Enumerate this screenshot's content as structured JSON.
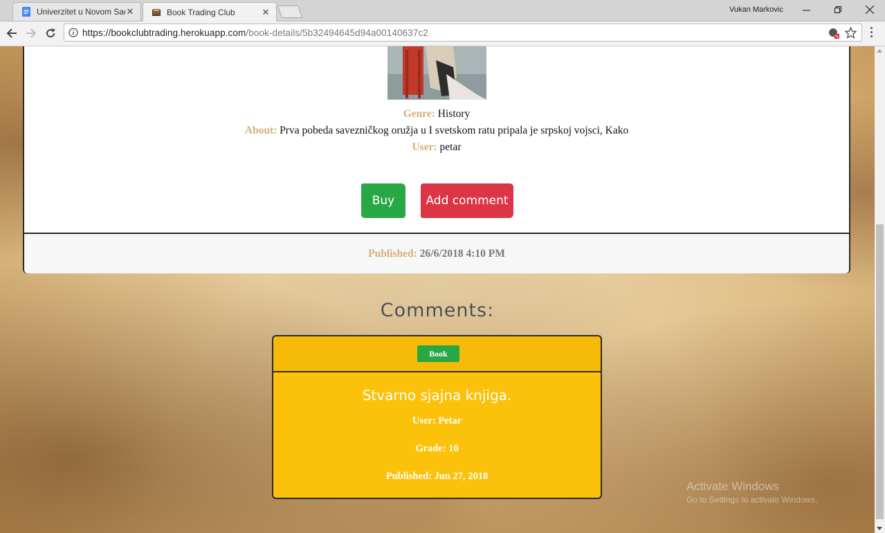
{
  "browser": {
    "tabs": [
      {
        "title": "Univerzitet u Novom Sad",
        "active": false,
        "favicon": "docs-icon"
      },
      {
        "title": "Book Trading Club",
        "active": true,
        "favicon": "book-icon"
      }
    ],
    "profile_name": "Vukan Markovic",
    "url_host": "https://bookclubtrading.herokuapp.com",
    "url_path": "/book-details/5b32494645d94a00140637c2"
  },
  "book": {
    "genre_label": "Genre:",
    "genre": "History",
    "about_label": "About:",
    "about": "Prva pobeda savezničkog oružja u I svetskom ratu pripala je srpskoj vojsci, Kako",
    "user_label": "User:",
    "user": "petar",
    "buy_label": "Buy",
    "add_comment_label": "Add comment",
    "published_label": "Published:",
    "published": "26/6/2018 4:10 PM"
  },
  "comments": {
    "heading": "Comments:",
    "items": [
      {
        "badge": "Book",
        "title": "Stvarno sjajna knjiga.",
        "user": "User: Petar",
        "grade": "Grade: 10",
        "published": "Published: Jun 27, 2018"
      }
    ]
  },
  "watermark": {
    "line1": "Activate Windows",
    "line2": "Go to Settings to activate Windows."
  },
  "colors": {
    "accent_label": "#d8ad78",
    "buy_button": "#28a745",
    "comment_button": "#dc3545",
    "comment_card": "#fcc10a"
  }
}
